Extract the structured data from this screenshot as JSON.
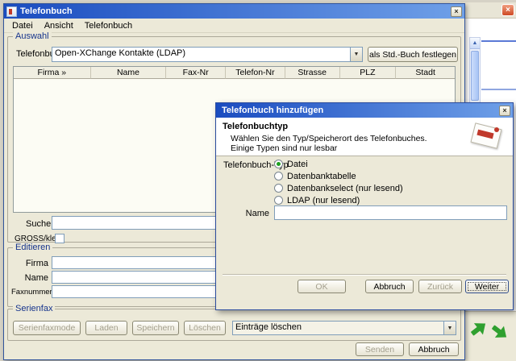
{
  "icons": {
    "close": "×",
    "combo_arrow": "▼",
    "scroll_up": "▲",
    "scroll_down": "▼"
  },
  "colors": {
    "titlebar_start": "#1A4CC0",
    "titlebar_end": "#6FA0E8",
    "group_title": "#16348C",
    "radio_selected": "#1FA01F",
    "close_button_red": "#CE4A24"
  },
  "main_window": {
    "title": "Telefonbuch",
    "menu": [
      "Datei",
      "Ansicht",
      "Telefonbuch"
    ],
    "auswahl": {
      "legend": "Auswahl",
      "telefonbuch_label": "Telefonbuch",
      "combo_value": "Open-XChange Kontakte (LDAP)",
      "std_button_label": "als Std.-Buch festlegen",
      "table_headers": [
        "Firma »",
        "Name",
        "Fax-Nr",
        "Telefon-Nr",
        "Strasse",
        "PLZ",
        "Stadt"
      ],
      "suchen_label": "Suchen",
      "gross_klein_label": "GROSS/klein"
    },
    "editieren": {
      "legend": "Editieren",
      "firma_label": "Firma",
      "name_label": "Name",
      "fax_label": "Faxnummer"
    },
    "serienfax": {
      "legend": "Serienfax",
      "serienfaxmode_label": "Serienfaxmode",
      "laden_label": "Laden",
      "speichern_label": "Speichern",
      "loeschen_label": "Löschen",
      "eintraege_combo_value": "Einträge löschen"
    },
    "senden_label": "Senden",
    "abbruch_label": "Abbruch"
  },
  "dialog": {
    "title": "Telefonbuch hinzufügen",
    "header_title": "Telefonbuchtyp",
    "header_line1": "Wählen Sie den Typ/Speicherort des Telefonbuches.",
    "header_line2": "Einige Typen sind nur lesbar",
    "typ_label": "Telefonbuch-Typ",
    "radios": [
      {
        "label": "Datei",
        "selected": true
      },
      {
        "label": "Datenbanktabelle",
        "selected": false
      },
      {
        "label": "Datenbankselect (nur lesend)",
        "selected": false
      },
      {
        "label": "LDAP (nur lesend)",
        "selected": false
      }
    ],
    "name_label": "Name",
    "ok_label": "OK",
    "abbruch_label": "Abbruch",
    "zurueck_label": "Zurück",
    "weiter_label": "Weiter"
  }
}
